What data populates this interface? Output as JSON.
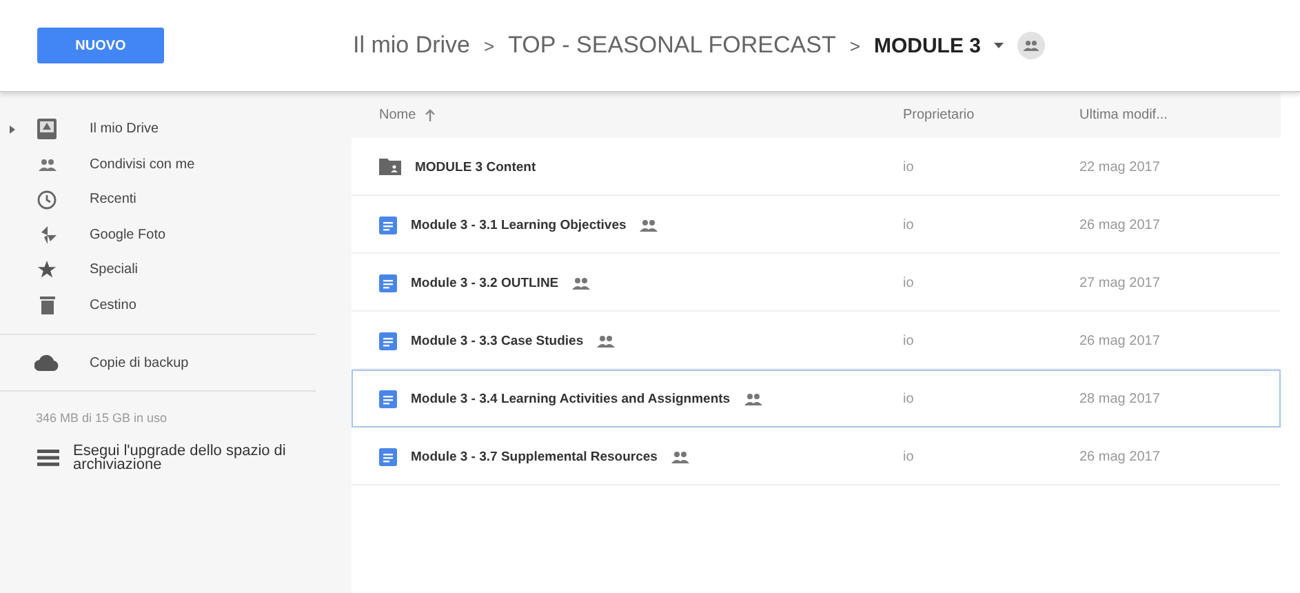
{
  "new_button": "NUOVO",
  "breadcrumb": [
    {
      "label": "Il mio Drive",
      "current": false
    },
    {
      "label": "TOP - SEASONAL FORECAST",
      "current": false
    },
    {
      "label": "MODULE 3",
      "current": true
    }
  ],
  "breadcrumb_separator": ">",
  "sidebar": {
    "items": [
      {
        "label": "Il mio Drive",
        "expandable": true
      },
      {
        "label": "Condivisi con me",
        "expandable": false
      },
      {
        "label": "Recenti",
        "expandable": false
      },
      {
        "label": "Google Foto",
        "expandable": false
      },
      {
        "label": "Speciali",
        "expandable": false
      },
      {
        "label": "Cestino",
        "expandable": false
      }
    ],
    "backup": "Copie di backup",
    "storage": "346 MB di 15 GB in uso",
    "upgrade": "Esegui l'upgrade dello spazio di archiviazione"
  },
  "table": {
    "columns": [
      "Nome",
      "Proprietario",
      "Ultima modif..."
    ],
    "rows": [
      {
        "kind": "folder",
        "name": "MODULE 3 Content",
        "shared": false,
        "owner": "io",
        "modified": "22 mag 2017",
        "selected": false
      },
      {
        "kind": "doc",
        "name": "Module 3 - 3.1 Learning Objectives",
        "shared": true,
        "owner": "io",
        "modified": "26 mag 2017",
        "selected": false
      },
      {
        "kind": "doc",
        "name": "Module 3 - 3.2 OUTLINE",
        "shared": true,
        "owner": "io",
        "modified": "27 mag 2017",
        "selected": false
      },
      {
        "kind": "doc",
        "name": "Module 3 - 3.3 Case Studies",
        "shared": true,
        "owner": "io",
        "modified": "26 mag 2017",
        "selected": false
      },
      {
        "kind": "doc",
        "name": "Module 3 - 3.4 Learning Activities and Assignments",
        "shared": true,
        "owner": "io",
        "modified": "28 mag 2017",
        "selected": true
      },
      {
        "kind": "doc",
        "name": "Module 3 - 3.7 Supplemental Resources",
        "shared": true,
        "owner": "io",
        "modified": "26 mag 2017",
        "selected": false
      }
    ]
  }
}
